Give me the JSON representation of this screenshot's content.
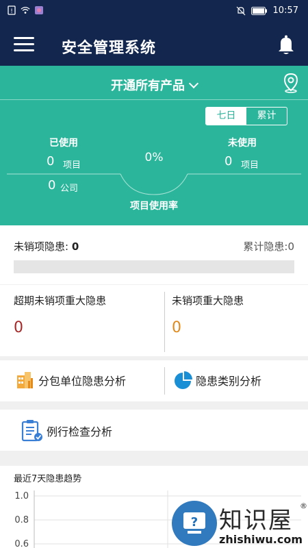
{
  "status_bar": {
    "time": "10:57"
  },
  "app_bar": {
    "title": "安全管理系统"
  },
  "product": {
    "selected": "开通所有产品"
  },
  "period_toggle": {
    "options": [
      "七日",
      "累计"
    ],
    "active": 0
  },
  "usage": {
    "used_label": "已使用",
    "used_projects": "0",
    "project_unit": "项目",
    "used_companies": "0",
    "company_unit": "公司",
    "unused_label": "未使用",
    "unused_projects": "0",
    "rate_value": "0%",
    "rate_label": "项目使用率"
  },
  "hazards": {
    "open_label": "未销项隐患:",
    "open_count": "0",
    "total_label": "累计隐患:",
    "total_count": "0"
  },
  "major": {
    "overdue_label": "超期未销项重大隐患",
    "overdue_count": "0",
    "open_label": "未销项重大隐患",
    "open_count": "0",
    "overdue_color": "#a52a2a",
    "open_color": "#e08a1e"
  },
  "analysis": {
    "subcontractor_label": "分包单位隐患分析",
    "category_label": "隐患类别分析",
    "routine_label": "例行检查分析"
  },
  "trend": {
    "title": "最近7天隐患趋势",
    "y_ticks": [
      "1.0",
      "0.8",
      "0.6"
    ]
  },
  "watermark": {
    "brand": "知识屋",
    "url": "zhishiwu.com"
  },
  "colors": {
    "navy": "#13264d",
    "teal": "#2bb69b"
  }
}
